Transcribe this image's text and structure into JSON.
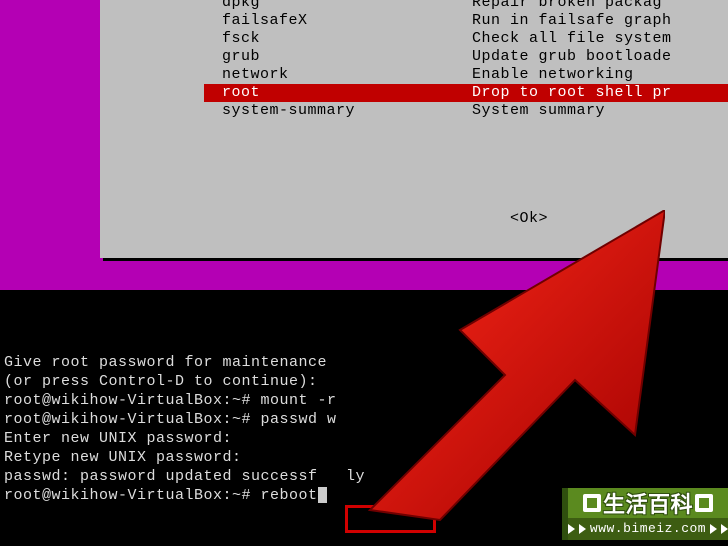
{
  "menu": {
    "selectedIndex": 5,
    "items": [
      {
        "name": "dpkg",
        "desc": "Repair broken packag"
      },
      {
        "name": "failsafeX",
        "desc": "Run in failsafe graph"
      },
      {
        "name": "fsck",
        "desc": "Check all file system"
      },
      {
        "name": "grub",
        "desc": "Update grub bootloade"
      },
      {
        "name": "network",
        "desc": "Enable networking"
      },
      {
        "name": "root",
        "desc": "Drop to root shell pr"
      },
      {
        "name": "system-summary",
        "desc": "System summary"
      }
    ],
    "ok": "<Ok>"
  },
  "term": {
    "l1": "Give root password for maintenance",
    "l2": "(or press Control-D to continue):",
    "l3": "root@wikihow-VirtualBox:~# mount -r",
    "l4": "root@wikihow-VirtualBox:~# passwd w",
    "l5": "Enter new UNIX password:",
    "l6": "Retype new UNIX password:",
    "l7": "passwd: password updated successf   ly",
    "l8a": "root@wikihow-VirtualBox:~# ",
    "l8b": "reboot"
  },
  "watermark": {
    "title": "生活百科",
    "url": "www.bimeiz.com"
  }
}
